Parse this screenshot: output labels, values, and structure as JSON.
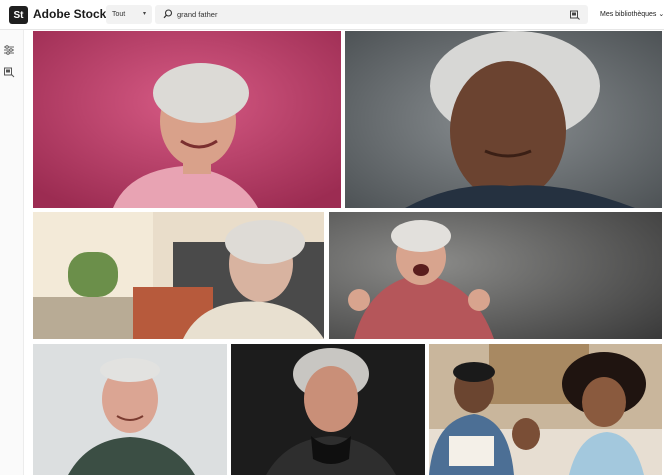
{
  "app": {
    "logo_mark": "St",
    "logo_text": "Adobe Stock"
  },
  "search": {
    "filter_value": "Tout",
    "query": "grand father",
    "placeholder": ""
  },
  "header": {
    "libraries_label": "Mes bibliothèques"
  },
  "icons": {
    "filter": "sliders-icon",
    "visual_search": "visual-search-icon",
    "search": "search-icon",
    "chevron": "chevron-down-icon"
  },
  "results": [
    {
      "id": "r1",
      "subject": "elderly woman smiling on pink background"
    },
    {
      "id": "r2",
      "subject": "elderly woman portrait on grey background"
    },
    {
      "id": "r3",
      "subject": "elderly woman relaxing on sofa"
    },
    {
      "id": "r4",
      "subject": "angry elderly woman with clenched fists"
    },
    {
      "id": "r5",
      "subject": "elderly man smiling"
    },
    {
      "id": "r6",
      "subject": "elderly woman with scarf on black background"
    },
    {
      "id": "r7",
      "subject": "man and girls reading at home"
    }
  ],
  "colors": {
    "brand": "#1f1f1f",
    "search_bg": "#f2f2f2",
    "pink": "#c8436f",
    "grey_bg": "#6f7376"
  }
}
